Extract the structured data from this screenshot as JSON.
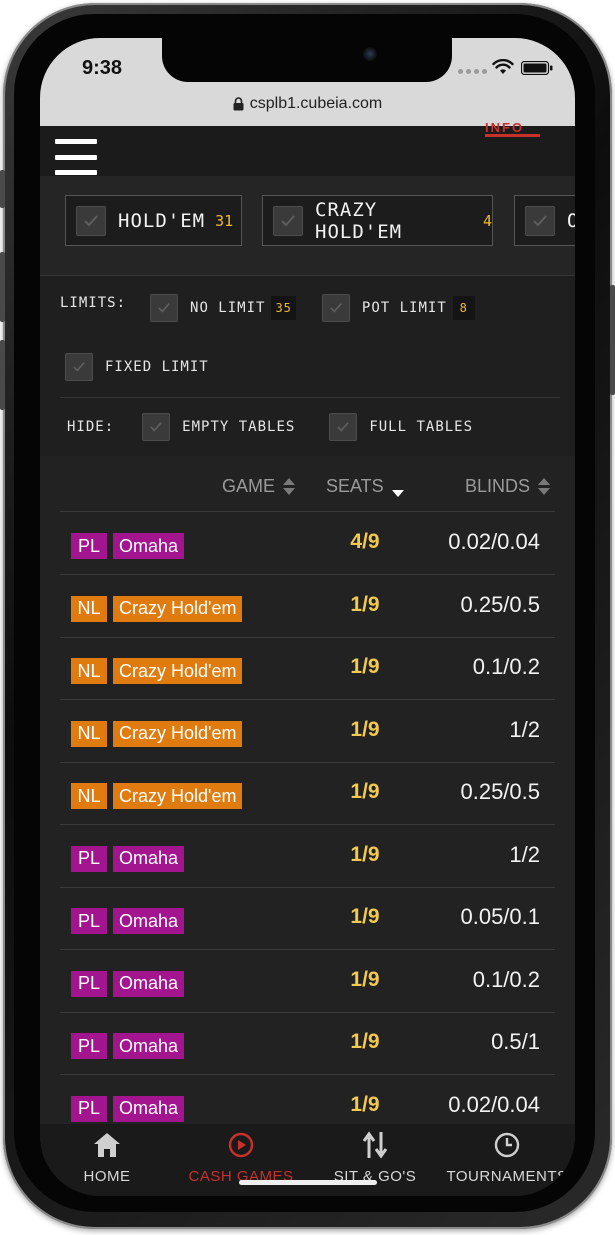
{
  "status_bar": {
    "time": "9:38",
    "url": "csplb1.cubeia.com"
  },
  "header": {
    "active_tab_clip": "INFO"
  },
  "game_tabs": [
    {
      "label": "HOLD'EM",
      "count": "31"
    },
    {
      "label": "CRAZY HOLD'EM",
      "count": "4"
    },
    {
      "label": "O",
      "count": ""
    }
  ],
  "limits": {
    "label": "LIMITS:",
    "options": [
      {
        "label": "NO LIMIT",
        "count": "35"
      },
      {
        "label": "POT LIMIT",
        "count": "8"
      },
      {
        "label": "FIXED LIMIT",
        "count": ""
      }
    ]
  },
  "hide": {
    "label": "HIDE:",
    "options": [
      {
        "label": "EMPTY TABLES"
      },
      {
        "label": "FULL TABLES"
      }
    ]
  },
  "table": {
    "columns": {
      "game": "GAME",
      "seats": "SEATS",
      "blinds": "BLINDS"
    },
    "sorted_by": "SEATS",
    "rows": [
      {
        "limit": "PL",
        "game": "Omaha",
        "seats": "4/9",
        "blinds": "0.02/0.04"
      },
      {
        "limit": "NL",
        "game": "Crazy Hold'em",
        "seats": "1/9",
        "blinds": "0.25/0.5"
      },
      {
        "limit": "NL",
        "game": "Crazy Hold'em",
        "seats": "1/9",
        "blinds": "0.1/0.2"
      },
      {
        "limit": "NL",
        "game": "Crazy Hold'em",
        "seats": "1/9",
        "blinds": "1/2"
      },
      {
        "limit": "NL",
        "game": "Crazy Hold'em",
        "seats": "1/9",
        "blinds": "0.25/0.5"
      },
      {
        "limit": "PL",
        "game": "Omaha",
        "seats": "1/9",
        "blinds": "1/2"
      },
      {
        "limit": "PL",
        "game": "Omaha",
        "seats": "1/9",
        "blinds": "0.05/0.1"
      },
      {
        "limit": "PL",
        "game": "Omaha",
        "seats": "1/9",
        "blinds": "0.1/0.2"
      },
      {
        "limit": "PL",
        "game": "Omaha",
        "seats": "1/9",
        "blinds": "0.5/1"
      },
      {
        "limit": "PL",
        "game": "Omaha",
        "seats": "1/9",
        "blinds": "0.02/0.04"
      }
    ]
  },
  "badge_colors": {
    "PL": "#a3148f",
    "NL": "#e07b10"
  },
  "bottom_nav": [
    {
      "label": "HOME",
      "icon": "home-icon",
      "active": false
    },
    {
      "label": "CASH GAMES",
      "icon": "play-circle-icon",
      "active": true
    },
    {
      "label": "SIT & GO'S",
      "icon": "sort-arrows-icon",
      "active": false
    },
    {
      "label": "TOURNAMENTS",
      "icon": "clock-icon",
      "active": false
    }
  ],
  "colors": {
    "accent": "#c8312b",
    "count_yellow": "#f0b92c",
    "background": "#1e1e1e"
  }
}
